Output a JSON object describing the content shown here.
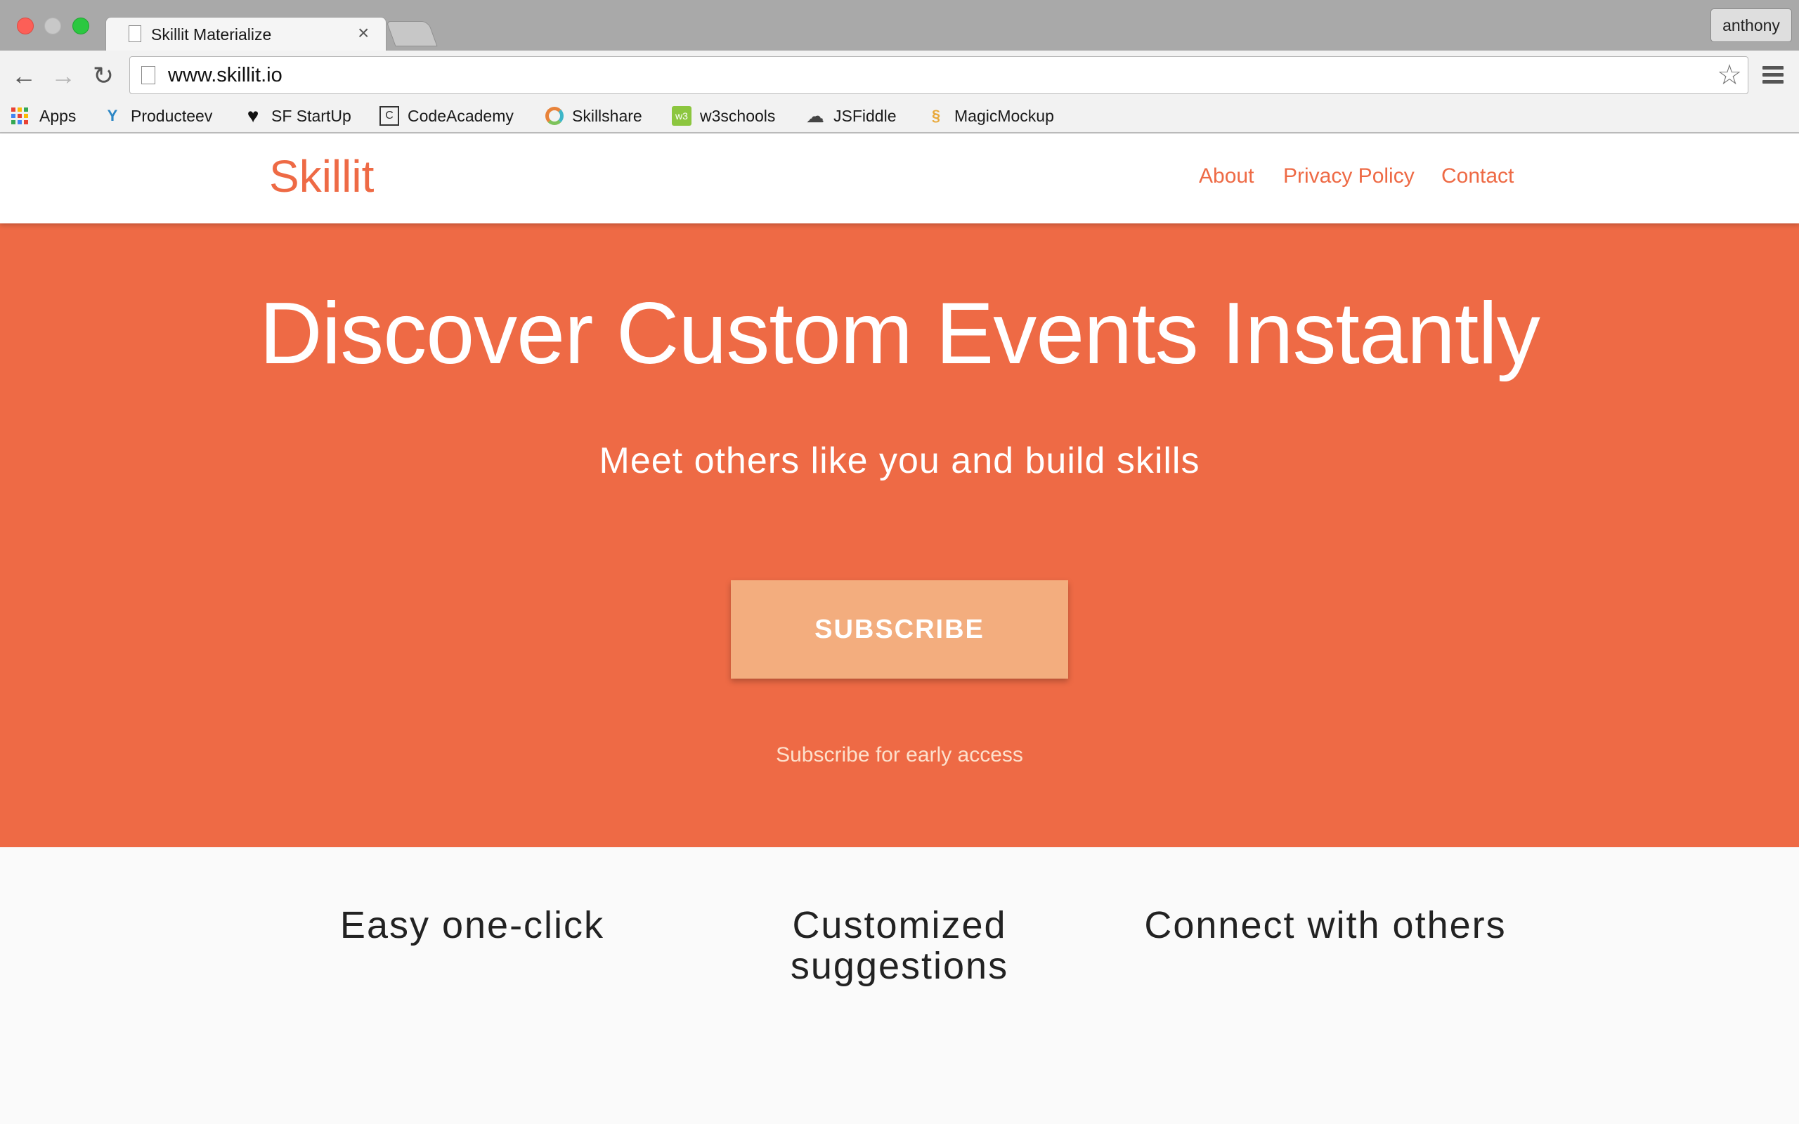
{
  "browser": {
    "tab_title": "Skillit Materialize",
    "tab_close": "×",
    "profile_name": "anthony",
    "url": "www.skillit.io",
    "back_icon": "←",
    "forward_icon": "→",
    "reload_icon": "↻",
    "star_icon": "☆"
  },
  "bookmarks": [
    {
      "label": "Apps",
      "icon": "apps-grid-icon"
    },
    {
      "label": "Producteev",
      "icon": "producteev-icon"
    },
    {
      "label": "SF StartUp",
      "icon": "heart-icon"
    },
    {
      "label": "CodeAcademy",
      "icon": "codeacademy-icon"
    },
    {
      "label": "Skillshare",
      "icon": "skillshare-icon"
    },
    {
      "label": "w3schools",
      "icon": "w3schools-icon"
    },
    {
      "label": "JSFiddle",
      "icon": "cloud-icon"
    },
    {
      "label": "MagicMockup",
      "icon": "magicmockup-icon"
    }
  ],
  "site": {
    "logo": "Skillit",
    "nav": {
      "about": "About",
      "privacy": "Privacy Policy",
      "contact": "Contact"
    },
    "hero": {
      "title": "Discover Custom Events Instantly",
      "subtitle": "Meet others like you and build skills",
      "button": "SUBSCRIBE",
      "note": "Subscribe for early access"
    },
    "features": {
      "one": "Easy one-click",
      "two": "Customized suggestions",
      "three": "Connect with others"
    }
  },
  "colors": {
    "brand": "#ee6a45",
    "button": "#f3ad7e"
  }
}
